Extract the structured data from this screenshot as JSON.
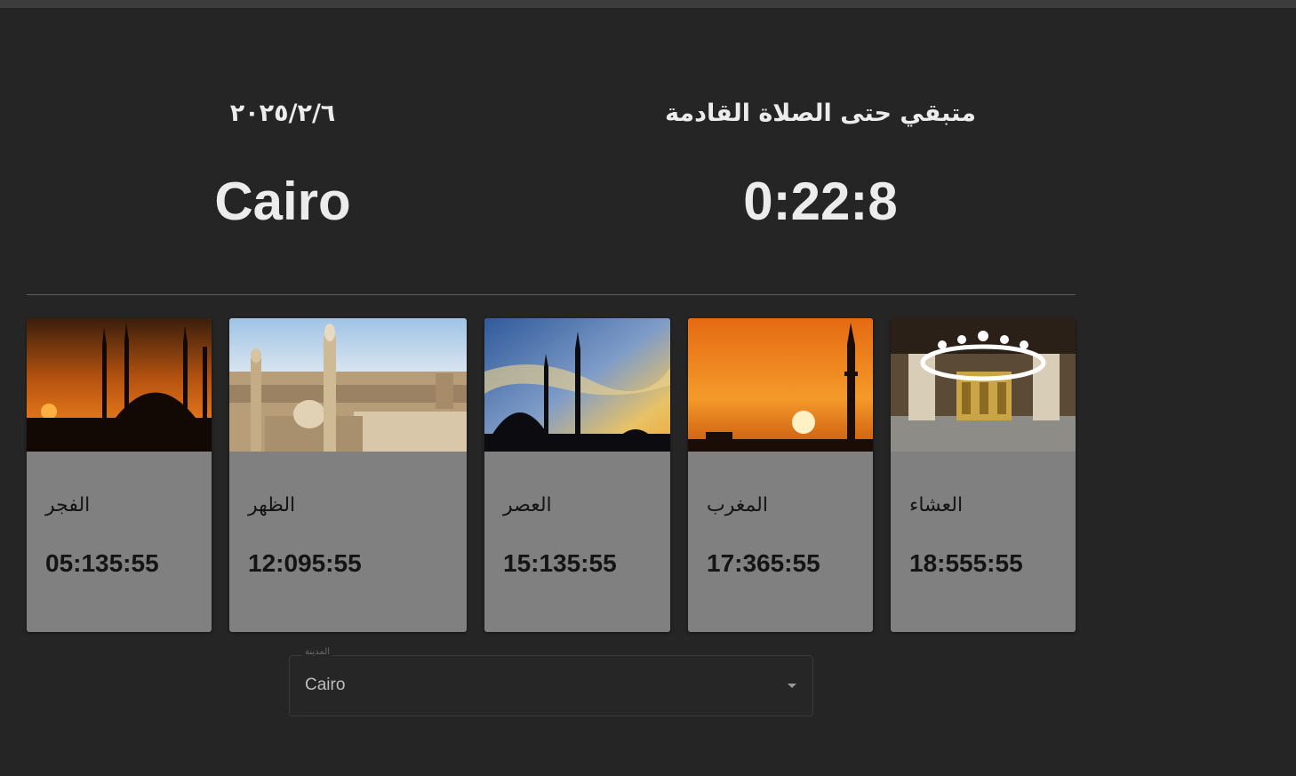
{
  "header": {
    "date": "٢٠٢٥/٢/٦",
    "remaining_label": "متبقي حتى الصلاة القادمة",
    "city": "Cairo",
    "countdown": "0:22:8"
  },
  "prayers": [
    {
      "name": "الفجر",
      "time": "05:135:55"
    },
    {
      "name": "الظهر",
      "time": "12:095:55"
    },
    {
      "name": "العصر",
      "time": "15:135:55"
    },
    {
      "name": "المغرب",
      "time": "17:365:55"
    },
    {
      "name": "العشاء",
      "time": "18:555:55"
    }
  ],
  "city_select": {
    "label": "المدينة",
    "value": "Cairo"
  },
  "colors": {
    "background": "#252525",
    "card": "#808080",
    "text_light": "#ececec",
    "text_dark": "#141414"
  }
}
